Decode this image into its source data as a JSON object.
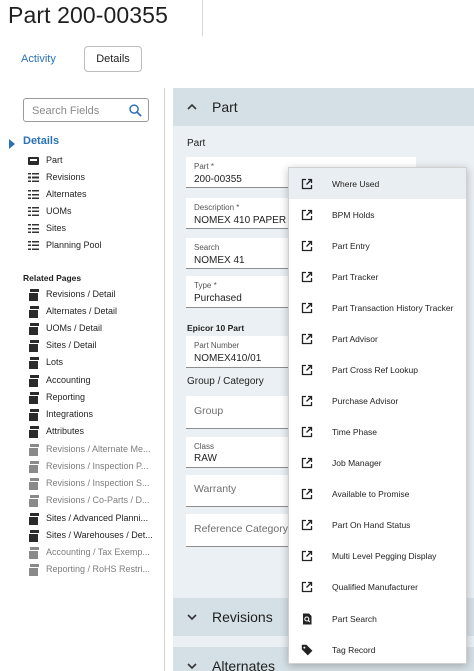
{
  "header": {
    "title": "Part 200-00355",
    "tabs": {
      "activity": "Activity",
      "details": "Details"
    }
  },
  "sidebar": {
    "search_placeholder": "Search Fields",
    "details_heading": "Details",
    "detail_items": [
      {
        "label": "Part",
        "icon": "card-icon"
      },
      {
        "label": "Revisions",
        "icon": "list-icon"
      },
      {
        "label": "Alternates",
        "icon": "list-icon"
      },
      {
        "label": "UOMs",
        "icon": "list-icon"
      },
      {
        "label": "Sites",
        "icon": "list-icon"
      },
      {
        "label": "Planning Pool",
        "icon": "list-icon"
      }
    ],
    "related_heading": "Related Pages",
    "related_items": [
      {
        "label": "Revisions / Detail",
        "enabled": true
      },
      {
        "label": "Alternates / Detail",
        "enabled": true
      },
      {
        "label": "UOMs / Detail",
        "enabled": true
      },
      {
        "label": "Sites / Detail",
        "enabled": true
      },
      {
        "label": "Lots",
        "enabled": true
      },
      {
        "label": "Accounting",
        "enabled": true
      },
      {
        "label": "Reporting",
        "enabled": true
      },
      {
        "label": "Integrations",
        "enabled": true
      },
      {
        "label": "Attributes",
        "enabled": true
      },
      {
        "label": "Revisions / Alternate Me...",
        "enabled": false
      },
      {
        "label": "Revisions / Inspection P...",
        "enabled": false
      },
      {
        "label": "Revisions / Inspection S...",
        "enabled": false
      },
      {
        "label": "Revisions / Co-Parts / D...",
        "enabled": false
      },
      {
        "label": "Sites / Advanced Planni...",
        "enabled": true
      },
      {
        "label": "Sites / Warehouses / Det...",
        "enabled": true
      },
      {
        "label": "Accounting / Tax Exemp...",
        "enabled": false
      },
      {
        "label": "Reporting / RoHS Restri...",
        "enabled": false
      }
    ]
  },
  "main": {
    "section_part": "Part",
    "group_part": "Part",
    "fields": {
      "part": {
        "label": "Part *",
        "value": "200-00355"
      },
      "description": {
        "label": "Description *",
        "value": "NOMEX 410 PAPER .0"
      },
      "search": {
        "label": "Search",
        "value": "NOMEX 41"
      },
      "type": {
        "label": "Type *",
        "value": "Purchased"
      },
      "epicor_heading": "Epicor 10 Part",
      "part_number": {
        "label": "Part Number",
        "value": "NOMEX410/01"
      },
      "group_category_heading": "Group / Category",
      "group": {
        "placeholder": "Group"
      },
      "class": {
        "label": "Class",
        "value": "RAW"
      },
      "warranty": {
        "placeholder": "Warranty"
      },
      "reference_category": {
        "placeholder": "Reference Category"
      }
    },
    "section_revisions": "Revisions",
    "section_alternates": "Alternates"
  },
  "context_menu": {
    "items": [
      {
        "label": "Where Used",
        "icon": "external-link-icon"
      },
      {
        "label": "BPM Holds",
        "icon": "external-link-icon"
      },
      {
        "label": "Part Entry",
        "icon": "external-link-icon"
      },
      {
        "label": "Part Tracker",
        "icon": "external-link-icon"
      },
      {
        "label": "Part Transaction History Tracker",
        "icon": "external-link-icon"
      },
      {
        "label": "Part Advisor",
        "icon": "external-link-icon"
      },
      {
        "label": "Part Cross Ref Lookup",
        "icon": "external-link-icon"
      },
      {
        "label": "Purchase Advisor",
        "icon": "external-link-icon"
      },
      {
        "label": "Time Phase",
        "icon": "external-link-icon"
      },
      {
        "label": "Job Manager",
        "icon": "external-link-icon"
      },
      {
        "label": "Available to Promise",
        "icon": "external-link-icon"
      },
      {
        "label": "Part On Hand Status",
        "icon": "external-link-icon"
      },
      {
        "label": "Multi Level Pegging Display",
        "icon": "external-link-icon"
      },
      {
        "label": "Qualified Manufacturer",
        "icon": "external-link-icon"
      },
      {
        "label": "Part Search",
        "icon": "search-doc-icon"
      },
      {
        "label": "Tag Record",
        "icon": "tag-icon"
      }
    ]
  },
  "colors": {
    "accent": "#2b72b6",
    "section_header": "#d5e0e6",
    "main_bg": "#eaf0f3"
  }
}
